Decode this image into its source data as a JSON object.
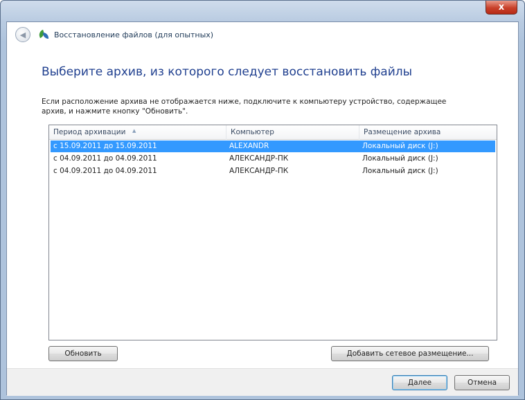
{
  "window": {
    "title": "Восстановление файлов (для опытных)",
    "close_glyph": "x"
  },
  "heading": "Выберите архив, из которого следует восстановить файлы",
  "instructions": "Если расположение архива не отображается ниже, подключите к компьютеру устройство, содержащее архив, и нажмите кнопку \"Обновить\".",
  "table": {
    "columns": [
      "Период архивации",
      "Компьютер",
      "Размещение архива"
    ],
    "rows": [
      {
        "period": "с 15.09.2011 до 15.09.2011",
        "computer": "ALEXANDR",
        "location": "Локальный диск (J:)",
        "selected": true
      },
      {
        "period": "с 04.09.2011 до 04.09.2011",
        "computer": "АЛЕКСАНДР-ПК",
        "location": "Локальный диск (J:)",
        "selected": false
      },
      {
        "period": "с 04.09.2011 до 04.09.2011",
        "computer": "АЛЕКСАНДР-ПК",
        "location": "Локальный диск (J:)",
        "selected": false
      }
    ]
  },
  "buttons": {
    "refresh": "Обновить",
    "add_network": "Добавить сетевое размещение...",
    "next": "Далее",
    "cancel": "Отмена"
  },
  "icons": {
    "back": "back-arrow-icon",
    "app": "backup-restore-icon",
    "close": "close-icon"
  },
  "colors": {
    "selection": "#3399ff",
    "heading": "#1f3f8f",
    "close_button": "#c8402a"
  }
}
